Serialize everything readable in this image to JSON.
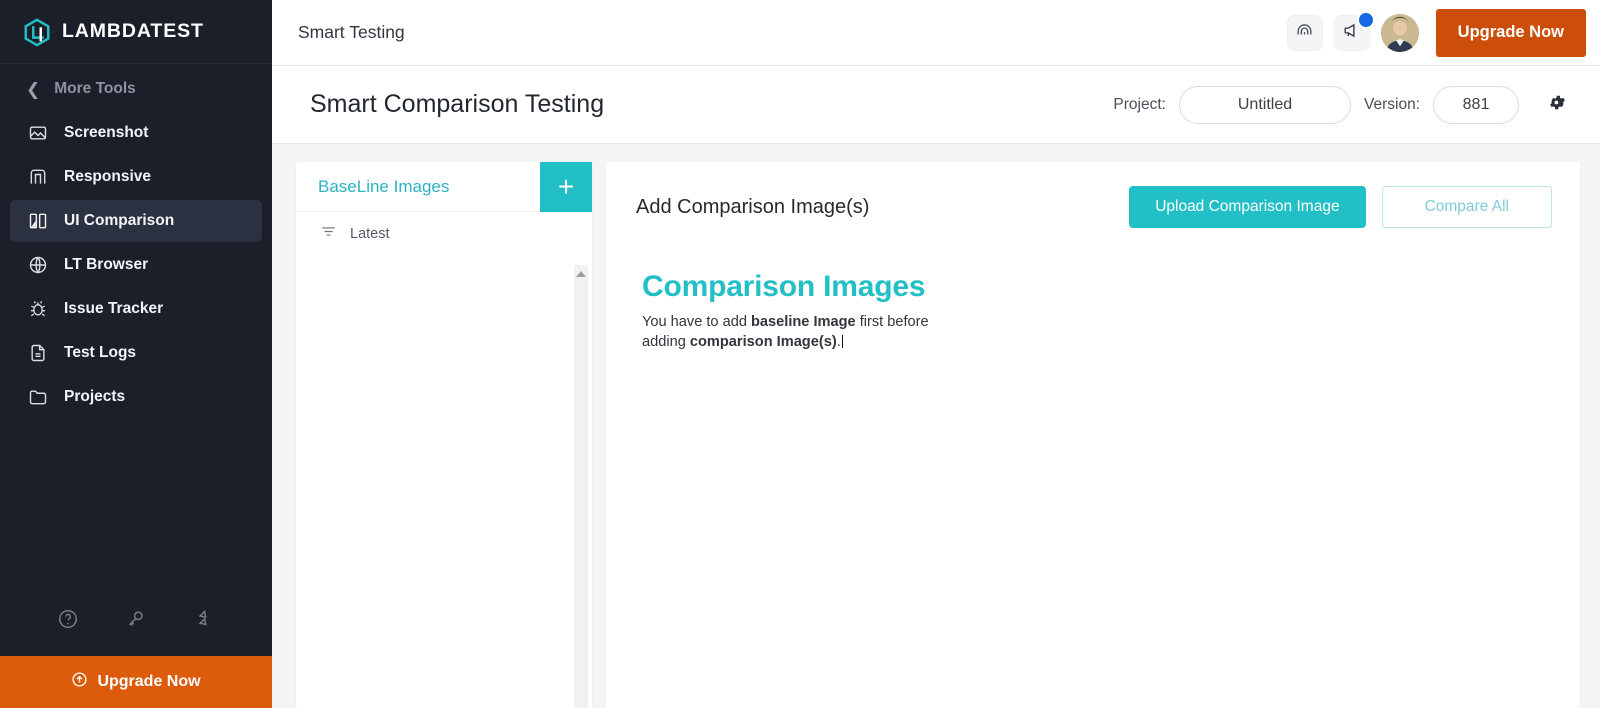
{
  "brand": {
    "name": "LAMBDATEST",
    "logo_icon": "lambdatest-hexagon-logo"
  },
  "sidebar": {
    "more_tools_label": "More Tools",
    "back_icon": "chevron-left-icon",
    "items": [
      {
        "label": "Screenshot",
        "icon": "image-icon",
        "active": false
      },
      {
        "label": "Responsive",
        "icon": "responsive-icon",
        "active": false
      },
      {
        "label": "UI Comparison",
        "icon": "ui-comparison-icon",
        "active": true
      },
      {
        "label": "LT Browser",
        "icon": "globe-icon",
        "active": false
      },
      {
        "label": "Issue Tracker",
        "icon": "bug-icon",
        "active": false
      },
      {
        "label": "Test Logs",
        "icon": "document-icon",
        "active": false
      },
      {
        "label": "Projects",
        "icon": "folder-icon",
        "active": false
      }
    ],
    "footer_icons": [
      "help-circle-icon",
      "key-icon",
      "integrations-icon"
    ],
    "upgrade_label": "Upgrade Now",
    "upgrade_icon": "arrow-up-circle-icon"
  },
  "topbar": {
    "title": "Smart Testing",
    "signal_icon": "signal-arc-icon",
    "announcement_icon": "megaphone-icon",
    "notification_badge": true,
    "avatar_name": "user-avatar",
    "upgrade_label": "Upgrade Now"
  },
  "pagebar": {
    "title": "Smart Comparison Testing",
    "project_label": "Project:",
    "project_value": "Untitled",
    "project_placeholder": "Untitled",
    "version_label": "Version:",
    "version_value": "881",
    "version_placeholder": "881",
    "settings_icon": "gear-icon"
  },
  "baseline_panel": {
    "title": "BaseLine Images",
    "add_label": "+",
    "filter_icon": "sort-filter-icon",
    "filter_label": "Latest",
    "scroll_up_icon": "scroll-up-arrow-icon"
  },
  "comparison_panel": {
    "title": "Add Comparison Image(s)",
    "upload_label": "Upload Comparison Image",
    "compare_label": "Compare All",
    "empty_title": "Comparison Images",
    "empty_text_1": "You have to add ",
    "empty_bold_1": "baseline Image",
    "empty_text_2": " first before adding ",
    "empty_bold_2": "comparison Image(s)",
    "empty_text_3": "."
  },
  "colors": {
    "teal": "#22bfc7",
    "teal_title": "#2bb3c0",
    "orange_top": "#cc4e0a",
    "orange_side": "#dd5c0c",
    "sidebar_bg": "#1b1f2a",
    "sidebar_active": "#2b3140",
    "badge_blue": "#1668e3",
    "page_bg": "#f4f5f7"
  }
}
